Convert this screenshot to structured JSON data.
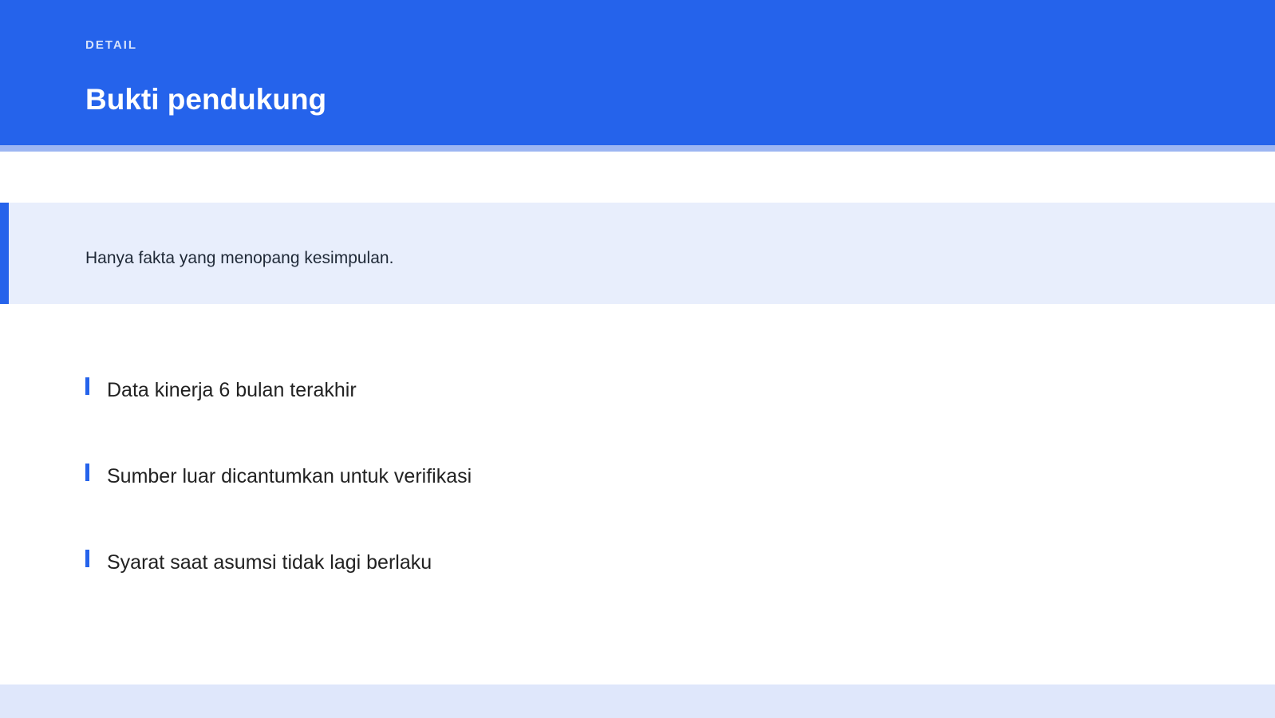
{
  "header": {
    "eyebrow": "DETAIL",
    "title": "Bukti pendukung"
  },
  "callout": {
    "text": "Hanya fakta yang menopang kesimpulan."
  },
  "list": {
    "items": [
      "Data kinerja 6 bulan terakhir",
      "Sumber luar dicantumkan untuk verifikasi",
      "Syarat saat asumsi tidak lagi berlaku"
    ]
  },
  "colors": {
    "accent": "#2563eb",
    "header_rule": "#9db6f2",
    "callout_bg": "#e8eefc",
    "footer_bg": "#dfe7fb"
  }
}
